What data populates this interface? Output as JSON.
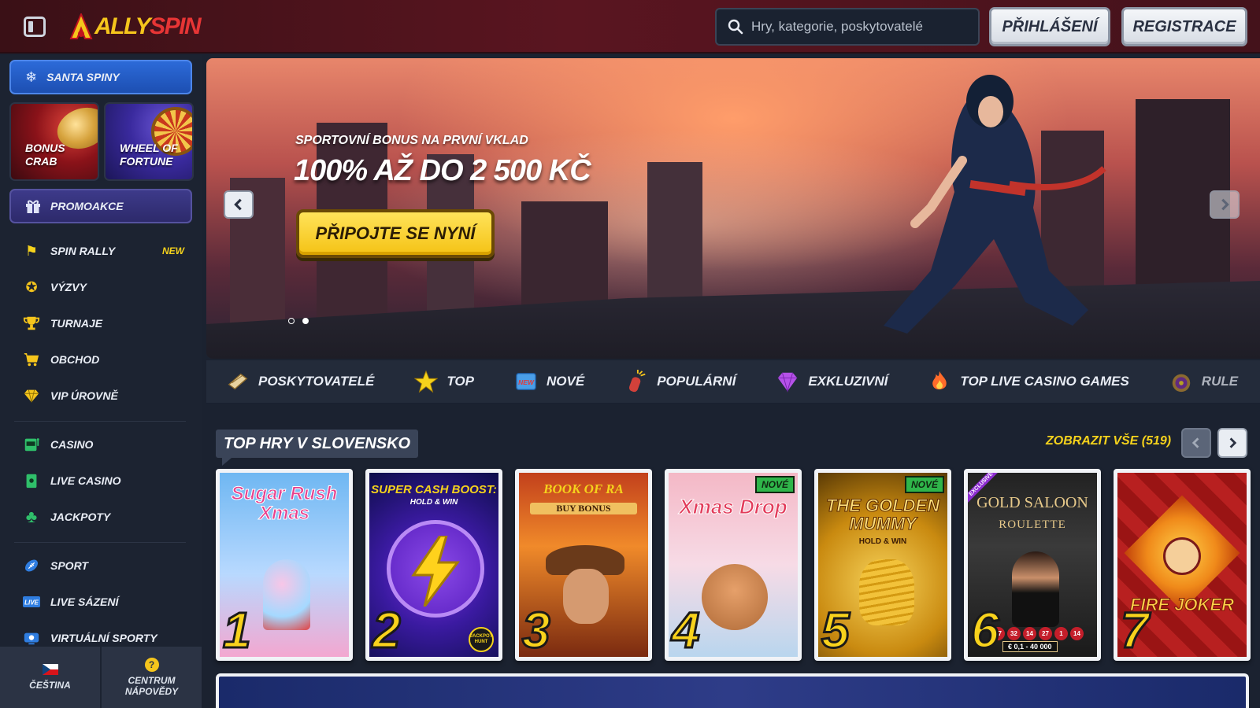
{
  "header": {
    "logo_text_a": "ALLY",
    "logo_text_b": "SPIN",
    "search_placeholder": "Hry, kategorie, poskytovatelé",
    "login_label": "PŘIHLÁŠENÍ",
    "register_label": "REGISTRACE"
  },
  "sidebar": {
    "santa_label": "SANTA SPINY",
    "tiles": [
      {
        "label": "BONUS CRAB"
      },
      {
        "label": "WHEEL OF FORTUNE"
      }
    ],
    "promo_label": "PROMOAKCE",
    "nav": [
      {
        "label": "SPIN RALLY",
        "badge": "NEW",
        "icon": "flag-icon"
      },
      {
        "label": "VÝZVY",
        "icon": "medal-icon"
      },
      {
        "label": "TURNAJE",
        "icon": "trophy-icon"
      },
      {
        "label": "OBCHOD",
        "icon": "cart-icon"
      },
      {
        "label": "VIP ÚROVNĚ",
        "icon": "diamond-icon"
      },
      {
        "label": "CASINO",
        "icon": "slot-icon"
      },
      {
        "label": "LIVE CASINO",
        "icon": "live-cards-icon"
      },
      {
        "label": "JACKPOTY",
        "icon": "clover-icon"
      },
      {
        "label": "SPORT",
        "icon": "football-icon"
      },
      {
        "label": "LIVE SÁZENÍ",
        "icon": "live-icon"
      },
      {
        "label": "VIRTUÁLNÍ SPORTY",
        "icon": "virtual-icon"
      }
    ],
    "footer": {
      "language": "ČEŠTINA",
      "help": "CENTRUM NÁPOVĚDY"
    }
  },
  "hero": {
    "subtitle": "SPORTOVNÍ BONUS NA PRVNÍ VKLAD",
    "title": "100% AŽ DO 2 500 KČ",
    "cta": "PŘIPOJTE SE NYNÍ",
    "slide_count": 2,
    "active_slide": 2
  },
  "categories": [
    {
      "label": "POSKYTOVATELÉ",
      "icon": "scroll-icon"
    },
    {
      "label": "TOP",
      "icon": "star-icon"
    },
    {
      "label": "NOVÉ",
      "icon": "new-tag-icon"
    },
    {
      "label": "POPULÁRNÍ",
      "icon": "firecracker-icon"
    },
    {
      "label": "EXKLUZIVNÍ",
      "icon": "gem-icon"
    },
    {
      "label": "TOP LIVE CASINO GAMES",
      "icon": "flame-icon"
    },
    {
      "label": "RULE",
      "icon": "roulette-icon"
    }
  ],
  "section": {
    "title": "TOP HRY V SLOVENSKO",
    "view_all": "ZOBRAZIT VŠE (519)"
  },
  "games": [
    {
      "rank": "1",
      "title": "Sugar Rush Xmas"
    },
    {
      "rank": "2",
      "title": "SUPER CASH BOOST:",
      "subtitle": "HOLD & WIN",
      "corner": "JACKPOT HUNT"
    },
    {
      "rank": "3",
      "title": "BOOK OF RA",
      "subtitle": "BUY BONUS"
    },
    {
      "rank": "4",
      "title": "Xmas Drop",
      "badge": "NOVÉ"
    },
    {
      "rank": "5",
      "title": "THE GOLDEN MUMMY",
      "subtitle": "HOLD & WIN",
      "badge": "NOVÉ"
    },
    {
      "rank": "6",
      "title": "GOLD SALOON",
      "subtitle": "ROULETTE",
      "ribbon": "EXCLUSIVE",
      "numbers": [
        "27",
        "32",
        "14",
        "27",
        "1",
        "14"
      ],
      "limits": "€ 0,1 - 40 000"
    },
    {
      "rank": "7",
      "title": "FIRE JOKER"
    }
  ],
  "colors": {
    "accent_yellow": "#f5d21c",
    "header_red": "#5a1520",
    "sidebar_bg": "#1c2331",
    "santa_blue": "#2c6ad8"
  }
}
